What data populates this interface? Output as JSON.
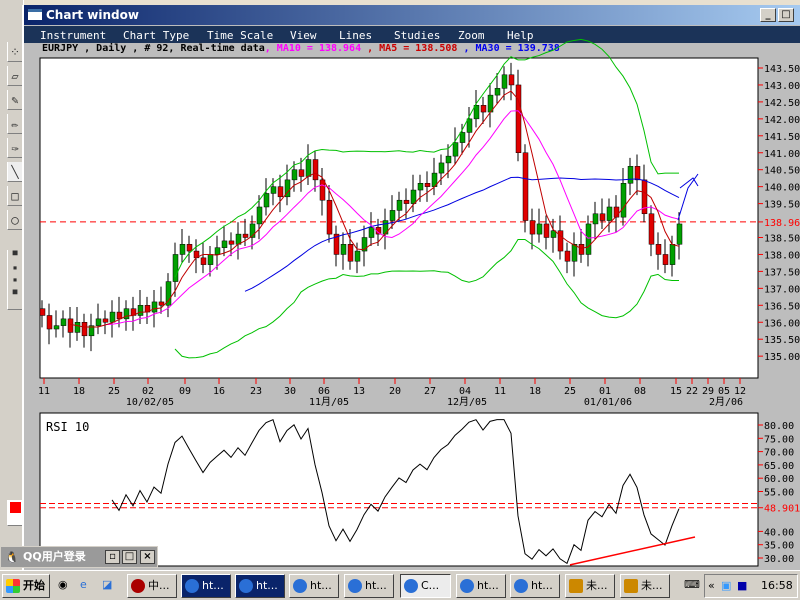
{
  "window": {
    "title": "Chart window"
  },
  "menu": [
    "Instrument",
    "Chart Type",
    "Time Scale",
    "View",
    "Lines",
    "Studies",
    "Zoom",
    "Help"
  ],
  "info": {
    "symbol": "EURJPY , Daily , # 92, Real-time data",
    "ma10": ", MA10 = 138.964",
    "ma5": ", MA5 = 138.508",
    "ma30": ", MA30 = 139.738"
  },
  "colors": {
    "up": "#00a000",
    "down": "#e00000",
    "ma5": "#c00000",
    "ma10": "#ff00ff",
    "ma30": "#0000e0",
    "bands": "#00c000",
    "marker": "#ff0000"
  },
  "chart_data": [
    {
      "type": "candlestick",
      "title": "EURJPY Daily",
      "ylim": [
        134.75,
        143.75
      ],
      "yticks": [
        "143.50",
        "143.00",
        "142.50",
        "142.00",
        "141.50",
        "141.00",
        "140.50",
        "140.00",
        "139.50",
        "138.96",
        "138.50",
        "138.00",
        "137.50",
        "137.00",
        "136.50",
        "136.00",
        "135.50",
        "135.00"
      ],
      "current_price": 138.96,
      "current_label": "138.96",
      "xticks": [
        "11",
        "18",
        "25",
        "02",
        "09",
        "16",
        "23",
        "30",
        "06",
        "13",
        "20",
        "27",
        "04",
        "11",
        "18",
        "25",
        "01",
        "08",
        "15",
        "22",
        "29",
        "05",
        "12"
      ],
      "xmonths": [
        "10/02/05",
        "11月/05",
        "12月/05",
        "01/01/06",
        "2月/06"
      ],
      "closes": [
        136.2,
        135.8,
        135.9,
        136.1,
        135.7,
        136.0,
        135.6,
        135.9,
        136.1,
        136.0,
        136.3,
        136.1,
        136.4,
        136.2,
        136.5,
        136.3,
        136.6,
        136.5,
        137.2,
        138.0,
        138.3,
        138.1,
        137.9,
        137.7,
        138.0,
        138.2,
        138.4,
        138.3,
        138.6,
        138.5,
        138.9,
        139.4,
        139.8,
        140.0,
        139.7,
        140.2,
        140.5,
        140.3,
        140.8,
        140.2,
        139.6,
        138.6,
        138.0,
        138.3,
        137.8,
        138.1,
        138.5,
        138.8,
        138.6,
        139.0,
        139.3,
        139.6,
        139.5,
        139.9,
        140.1,
        140.0,
        140.4,
        140.7,
        140.9,
        141.3,
        141.6,
        142.0,
        142.4,
        142.2,
        142.7,
        142.9,
        143.3,
        143.0,
        141.0,
        139.0,
        138.6,
        138.9,
        138.5,
        138.7,
        138.1,
        137.8,
        138.3,
        138.0,
        138.9,
        139.2,
        139.0,
        139.4,
        139.1,
        140.1,
        140.6,
        140.2,
        139.2,
        138.3,
        138.0,
        137.7,
        138.3,
        138.9
      ],
      "studies": [
        "MA5",
        "MA10",
        "MA30",
        "Bollinger Bands"
      ]
    },
    {
      "type": "line",
      "title": "RSI 10",
      "ylim": [
        26,
        82
      ],
      "yticks": [
        "80.00",
        "75.00",
        "70.00",
        "65.00",
        "60.00",
        "55.00",
        "48.901",
        "40.00",
        "35.00",
        "30.00"
      ],
      "current_value": 48.901,
      "current_label": "48.901",
      "reference_lines": [
        48.9,
        50.5
      ],
      "trendline": {
        "from": 27.4,
        "to": 37.9
      }
    }
  ],
  "qq": {
    "title": "QQ用户登录"
  },
  "taskbar": {
    "start": "开始",
    "items": [
      "中...",
      "ht...",
      "ht...",
      "ht...",
      "ht...",
      "C...",
      "ht...",
      "ht...",
      "未...",
      "未..."
    ],
    "clock": "16:58"
  }
}
